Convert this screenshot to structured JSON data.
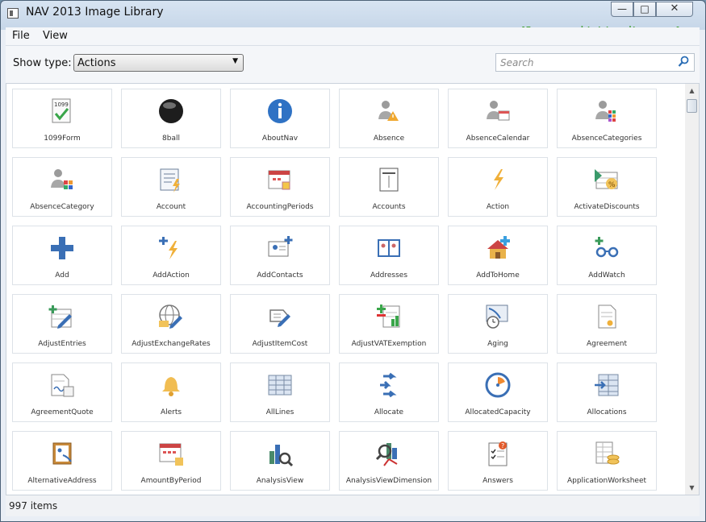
{
  "window": {
    "title": "NAV 2013 Image Library",
    "min_label": "—",
    "max_label": "□",
    "close_label": "✕"
  },
  "watermark": "[Image provided by mibuso.com]",
  "menu": [
    {
      "label": "File"
    },
    {
      "label": "View"
    }
  ],
  "toolbar": {
    "show_type_label": "Show type:",
    "show_type_value": "Actions",
    "search_placeholder": "Search"
  },
  "tiles": [
    {
      "label": "1099Form",
      "icon": "form-1099-icon"
    },
    {
      "label": "8ball",
      "icon": "8ball-icon"
    },
    {
      "label": "AboutNav",
      "icon": "info-icon"
    },
    {
      "label": "Absence",
      "icon": "person-warning-icon"
    },
    {
      "label": "AbsenceCalendar",
      "icon": "person-calendar-icon"
    },
    {
      "label": "AbsenceCategories",
      "icon": "person-categories-icon"
    },
    {
      "label": "AbsenceCategory",
      "icon": "person-category-icon"
    },
    {
      "label": "Account",
      "icon": "account-icon"
    },
    {
      "label": "AccountingPeriods",
      "icon": "calendar-periods-icon"
    },
    {
      "label": "Accounts",
      "icon": "accounts-icon"
    },
    {
      "label": "Action",
      "icon": "lightning-icon"
    },
    {
      "label": "ActivateDiscounts",
      "icon": "discount-icon"
    },
    {
      "label": "Add",
      "icon": "plus-icon"
    },
    {
      "label": "AddAction",
      "icon": "add-lightning-icon"
    },
    {
      "label": "AddContacts",
      "icon": "add-contact-icon"
    },
    {
      "label": "Addresses",
      "icon": "address-book-icon"
    },
    {
      "label": "AddToHome",
      "icon": "home-add-icon"
    },
    {
      "label": "AddWatch",
      "icon": "glasses-add-icon"
    },
    {
      "label": "AdjustEntries",
      "icon": "adjust-entries-icon"
    },
    {
      "label": "AdjustExchangeRates",
      "icon": "globe-pencil-icon"
    },
    {
      "label": "AdjustItemCost",
      "icon": "tag-pencil-icon"
    },
    {
      "label": "AdjustVATExemption",
      "icon": "vat-exemption-icon"
    },
    {
      "label": "Aging",
      "icon": "aging-clock-icon"
    },
    {
      "label": "Agreement",
      "icon": "agreement-icon"
    },
    {
      "label": "AgreementQuote",
      "icon": "agreement-quote-icon"
    },
    {
      "label": "Alerts",
      "icon": "bell-icon"
    },
    {
      "label": "AllLines",
      "icon": "table-lines-icon"
    },
    {
      "label": "Allocate",
      "icon": "allocate-arrows-icon"
    },
    {
      "label": "AllocatedCapacity",
      "icon": "capacity-gauge-icon"
    },
    {
      "label": "Allocations",
      "icon": "allocations-icon"
    },
    {
      "label": "AlternativeAddress",
      "icon": "alt-address-icon"
    },
    {
      "label": "AmountByPeriod",
      "icon": "amount-period-icon"
    },
    {
      "label": "AnalysisView",
      "icon": "analysis-view-icon"
    },
    {
      "label": "AnalysisViewDimension",
      "icon": "analysis-dimension-icon"
    },
    {
      "label": "Answers",
      "icon": "answers-icon"
    },
    {
      "label": "ApplicationWorksheet",
      "icon": "worksheet-coins-icon"
    }
  ],
  "status": {
    "item_count": "997 items"
  }
}
